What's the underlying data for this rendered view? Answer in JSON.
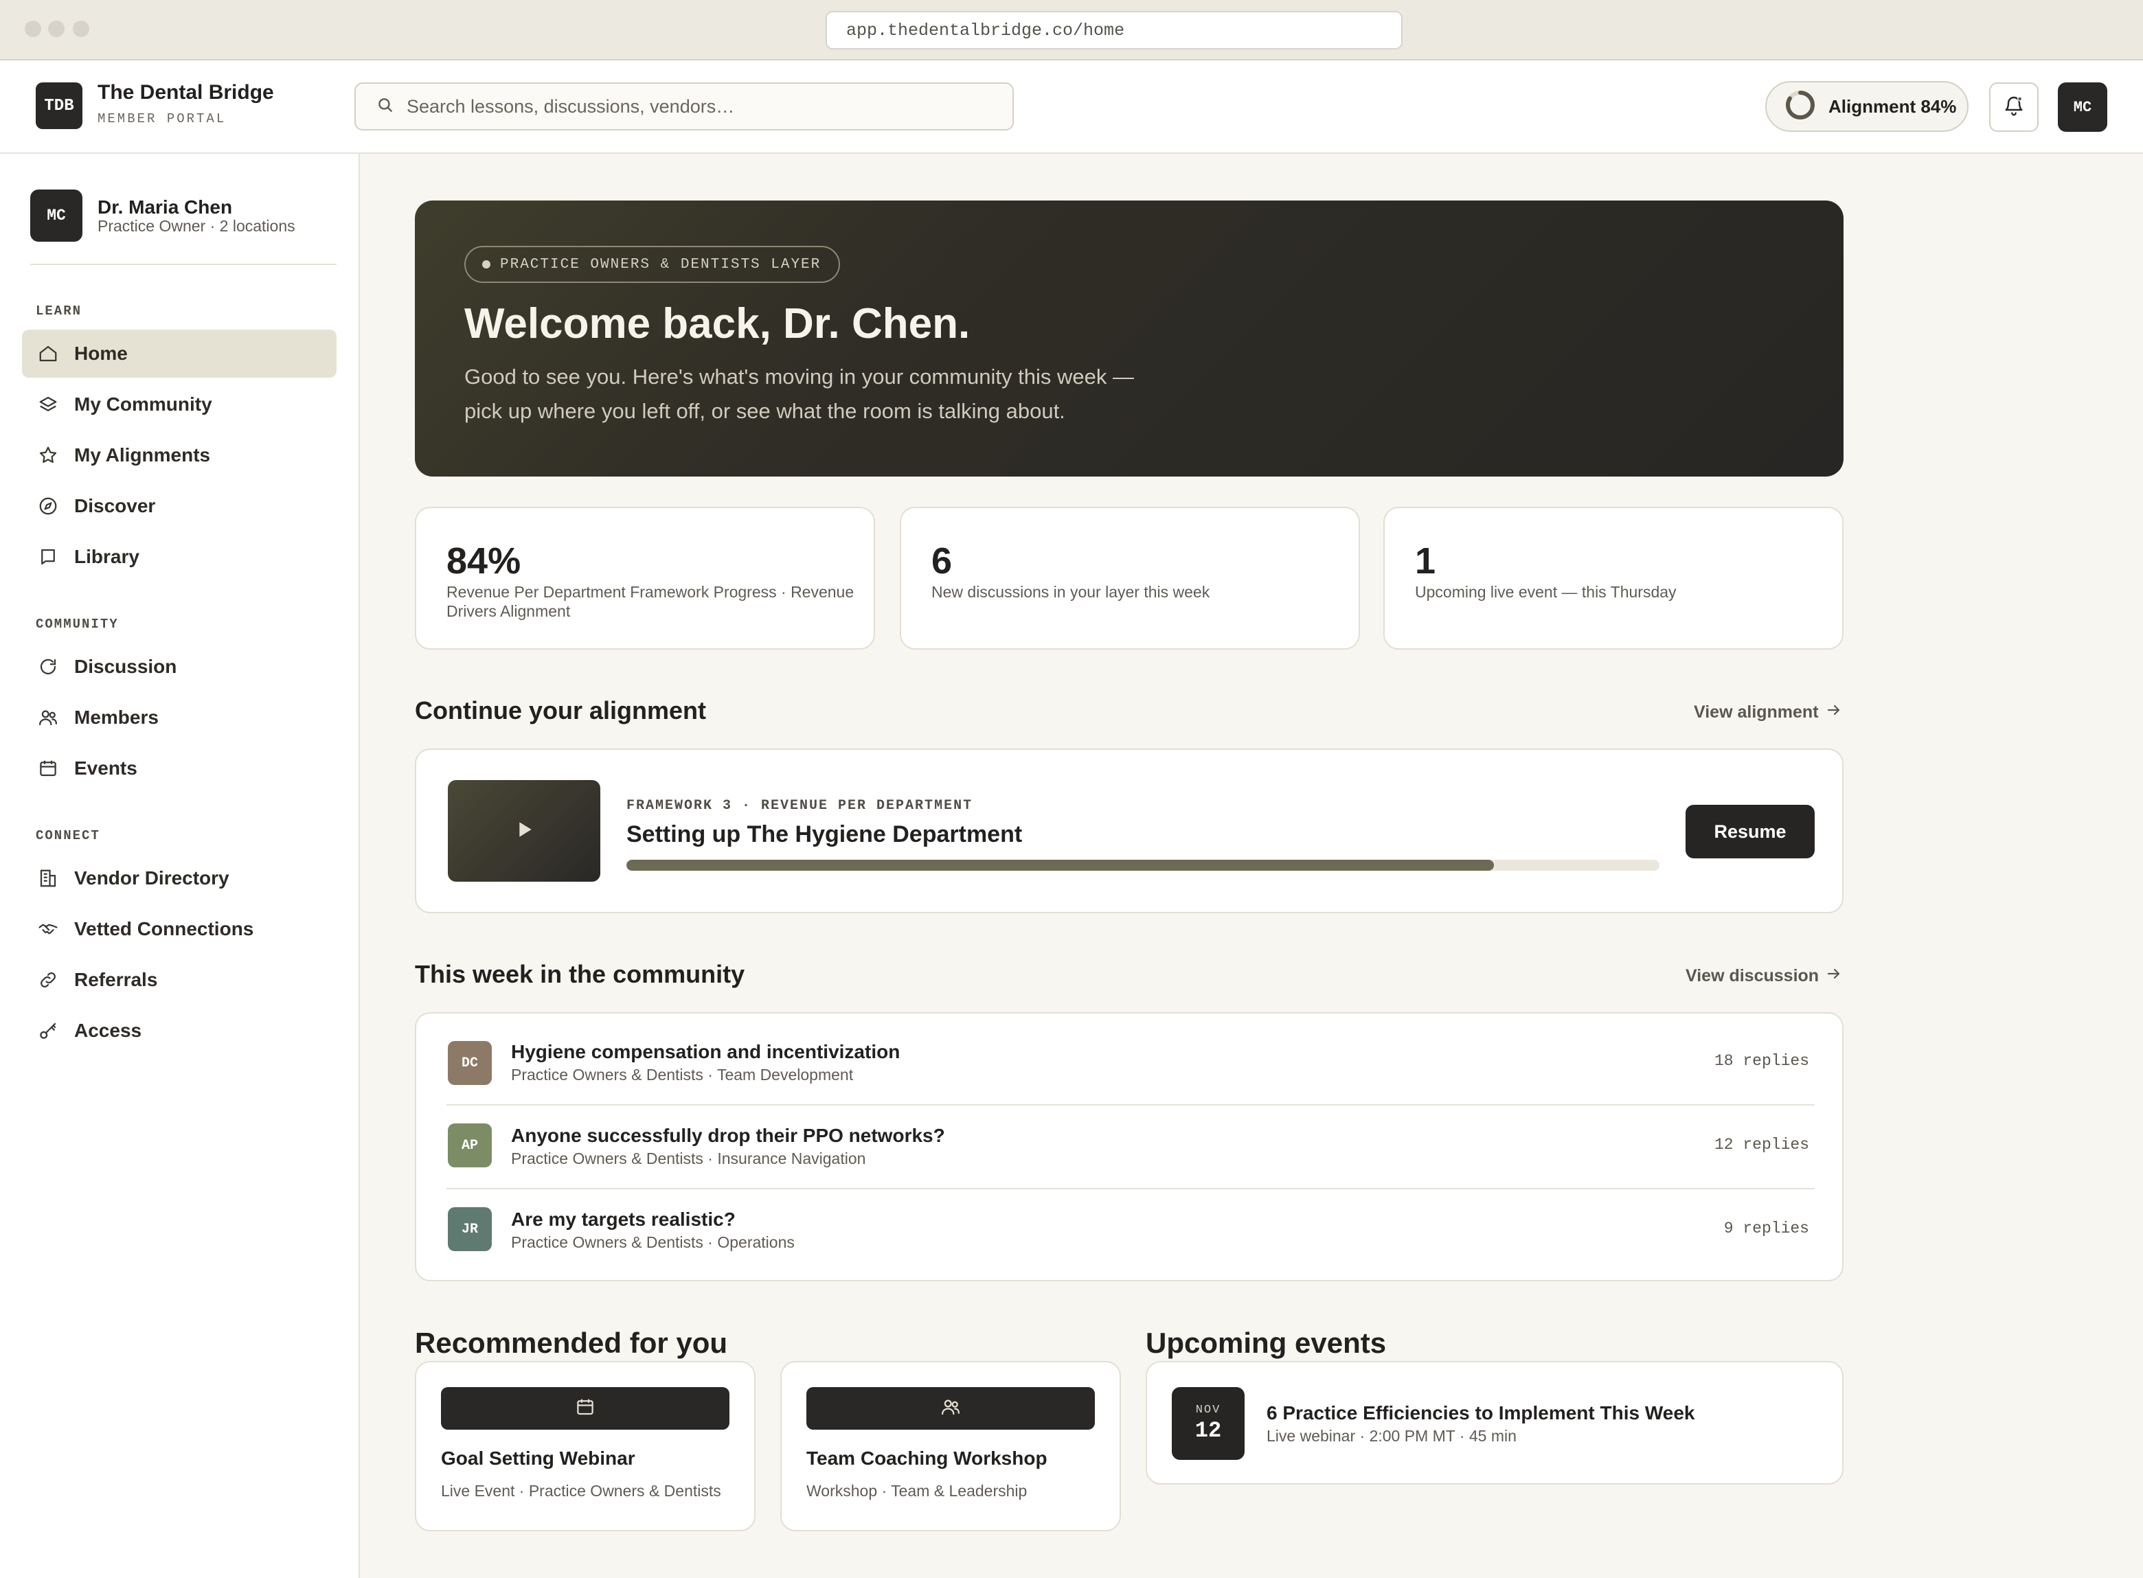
{
  "browser": {
    "url": "app.thedentalbridge.co/home"
  },
  "header": {
    "logo_text": "TDB",
    "brand_title": "The Dental Bridge",
    "brand_subtitle": "MEMBER PORTAL",
    "search_placeholder": "Search lessons, discussions, vendors…",
    "alignment_label": "Alignment 84%",
    "alignment_progress": 0.84,
    "avatar_initials": "MC"
  },
  "sidebar": {
    "user": {
      "initials": "MC",
      "name": "Dr. Maria Chen",
      "role": "Practice Owner · 2 locations"
    },
    "sections": [
      {
        "label": "LEARN",
        "items": [
          {
            "label": "Home",
            "icon": "home-icon",
            "active": true
          },
          {
            "label": "My Community",
            "icon": "layers-icon"
          },
          {
            "label": "My Alignments",
            "icon": "star-icon"
          },
          {
            "label": "Discover",
            "icon": "compass-icon"
          },
          {
            "label": "Library",
            "icon": "book-icon"
          }
        ]
      },
      {
        "label": "COMMUNITY",
        "items": [
          {
            "label": "Discussion",
            "icon": "refresh-icon"
          },
          {
            "label": "Members",
            "icon": "users-icon"
          },
          {
            "label": "Events",
            "icon": "calendar-icon"
          }
        ]
      },
      {
        "label": "CONNECT",
        "items": [
          {
            "label": "Vendor Directory",
            "icon": "building-icon"
          },
          {
            "label": "Vetted Connections",
            "icon": "handshake-icon"
          },
          {
            "label": "Referrals",
            "icon": "link-icon"
          },
          {
            "label": "Access",
            "icon": "key-icon"
          }
        ]
      }
    ]
  },
  "hero": {
    "tag": "PRACTICE OWNERS & DENTISTS LAYER",
    "title": "Welcome back, Dr. Chen.",
    "subtitle": "Good to see you. Here's what's moving in your community this week — pick up where you left off, or see what the room is talking about."
  },
  "stats": [
    {
      "value": "84%",
      "label": "Revenue Per Department Framework Progress · Revenue Drivers Alignment"
    },
    {
      "value": "6",
      "label": "New discussions in your layer this week"
    },
    {
      "value": "1",
      "label": "Upcoming live event — this Thursday"
    }
  ],
  "continue": {
    "title": "Continue your alignment",
    "link": "View alignment",
    "kicker": "FRAMEWORK 3 · REVENUE PER DEPARTMENT",
    "lesson_title": "Setting up The Hygiene Department",
    "progress": 0.84,
    "button": "Resume"
  },
  "community": {
    "title": "This week in the community",
    "link": "View discussion",
    "threads": [
      {
        "initials": "DC",
        "color": "#8c7966",
        "title": "Hygiene compensation and incentivization",
        "meta": "Practice Owners & Dentists · Team Development",
        "replies": "18 replies"
      },
      {
        "initials": "AP",
        "color": "#7c8d66",
        "title": "Anyone successfully drop their PPO networks?",
        "meta": "Practice Owners & Dentists · Insurance Navigation",
        "replies": "12 replies"
      },
      {
        "initials": "JR",
        "color": "#5f7a70",
        "title": "Are my targets realistic?",
        "meta": "Practice Owners & Dentists · Operations",
        "replies": "9 replies"
      }
    ]
  },
  "recommended": {
    "title": "Recommended for you",
    "items": [
      {
        "icon": "calendar-icon",
        "title": "Goal Setting Webinar",
        "meta": "Live Event · Practice Owners & Dentists"
      },
      {
        "icon": "users-icon",
        "title": "Team Coaching Workshop",
        "meta": "Workshop · Team & Leadership"
      }
    ]
  },
  "events": {
    "title": "Upcoming events",
    "items": [
      {
        "month": "NOV",
        "day": "12",
        "title": "6 Practice Efficiencies to Implement This Week",
        "meta": "Live webinar · 2:00 PM MT · 45 min"
      }
    ]
  }
}
